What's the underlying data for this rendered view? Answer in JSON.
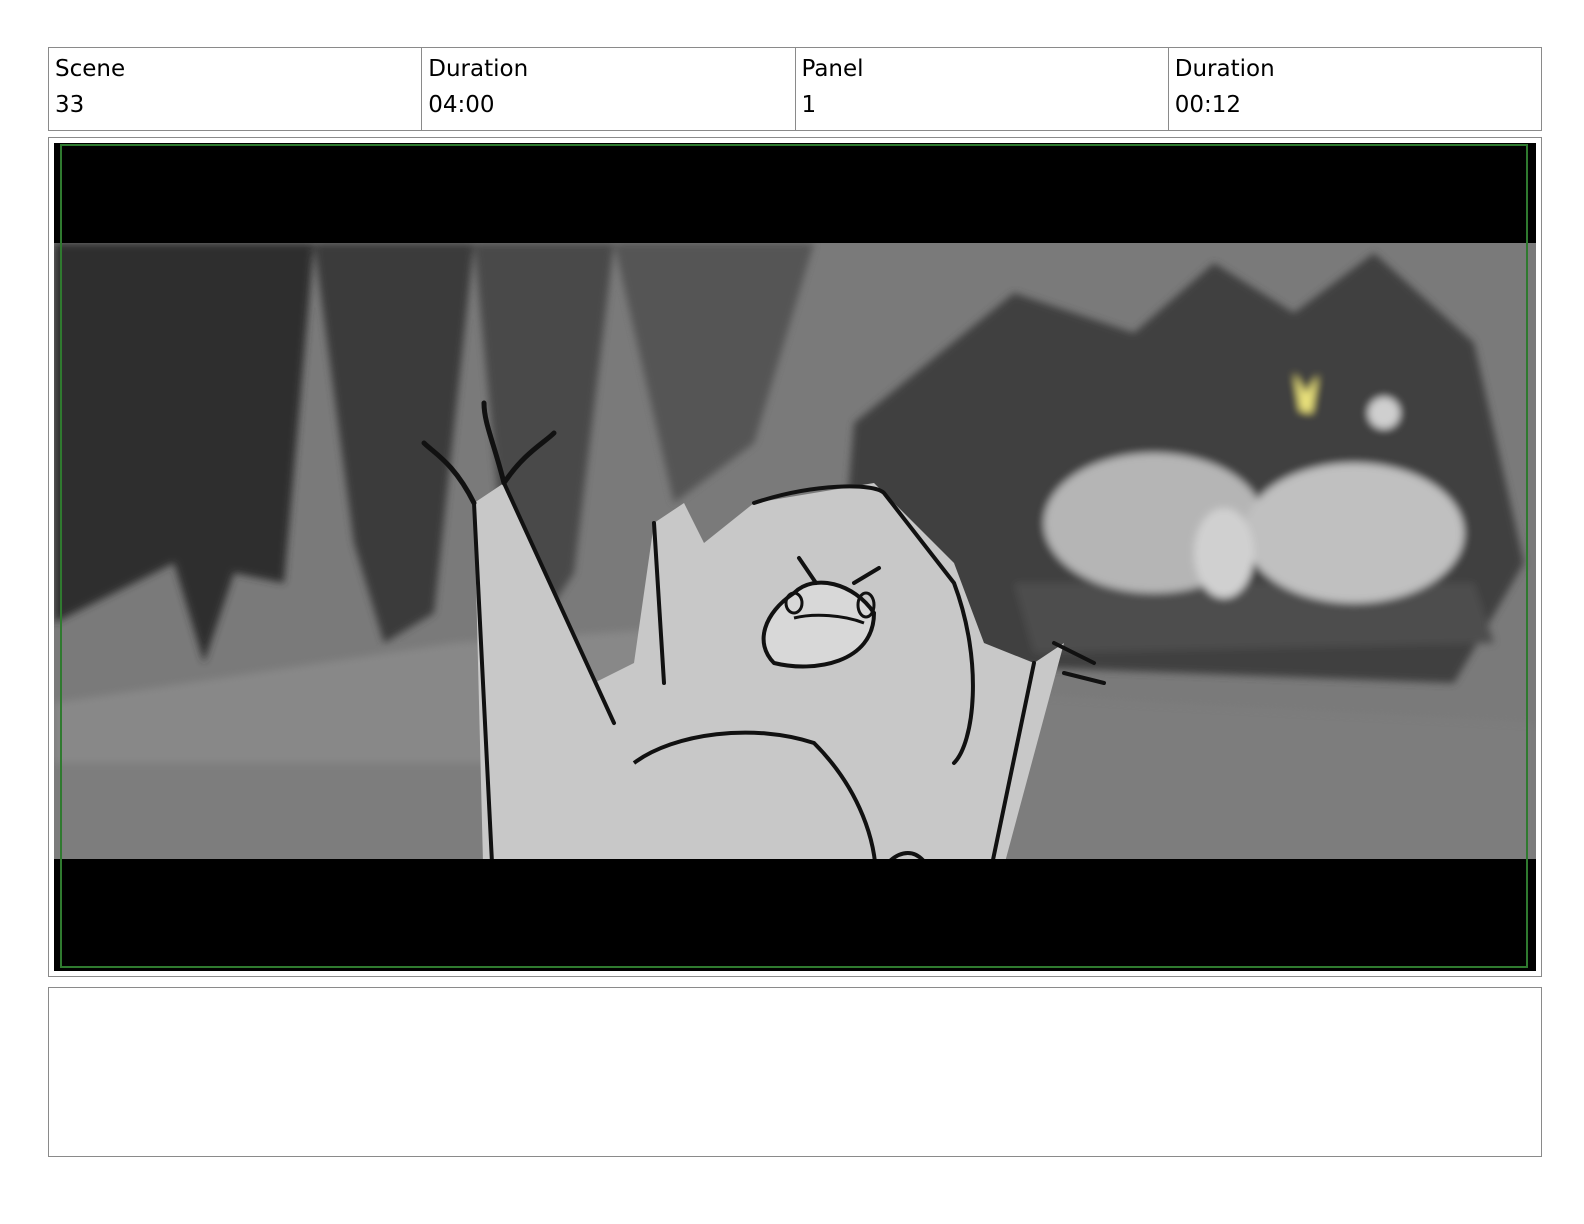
{
  "header": {
    "scene_label": "Scene",
    "scene_value": "33",
    "scene_duration_label": "Duration",
    "scene_duration_value": "04:00",
    "panel_label": "Panel",
    "panel_value": "1",
    "panel_duration_label": "Duration",
    "panel_duration_value": "00:12"
  },
  "panel": {
    "safe_frame_color": "#2f7a2f",
    "letterbox_color": "#000000",
    "accent_color": "#e8e07a"
  },
  "notes": {
    "text": ""
  }
}
